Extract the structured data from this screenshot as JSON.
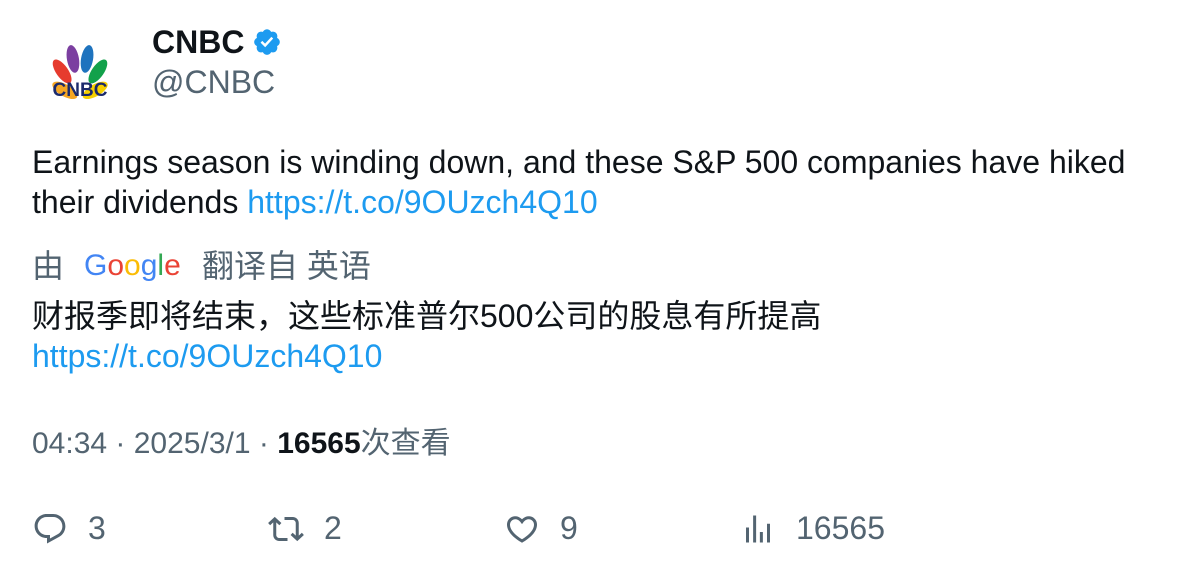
{
  "author": {
    "name": "CNBC",
    "handle": "@CNBC",
    "avatar_label": "CNBC"
  },
  "tweet": {
    "text": "Earnings season is winding down, and these S&P 500 companies have hiked their dividends ",
    "link": "https://t.co/9OUzch4Q10"
  },
  "translation": {
    "prefix": "由",
    "provider_icon": "google-logo",
    "suffix": "翻译自 英语",
    "text": "财报季即将结束，这些标准普尔500公司的股息有所提高",
    "link": "https://t.co/9OUzch4Q10"
  },
  "meta": {
    "time": "04:34",
    "date": "2025/3/1",
    "views": "16565",
    "views_label": "次查看"
  },
  "actions": {
    "replies": "3",
    "retweets": "2",
    "likes": "9",
    "views": "16565"
  },
  "colors": {
    "link": "#1d9bf0",
    "secondary": "#536471",
    "verified": "#1d9bf0"
  }
}
